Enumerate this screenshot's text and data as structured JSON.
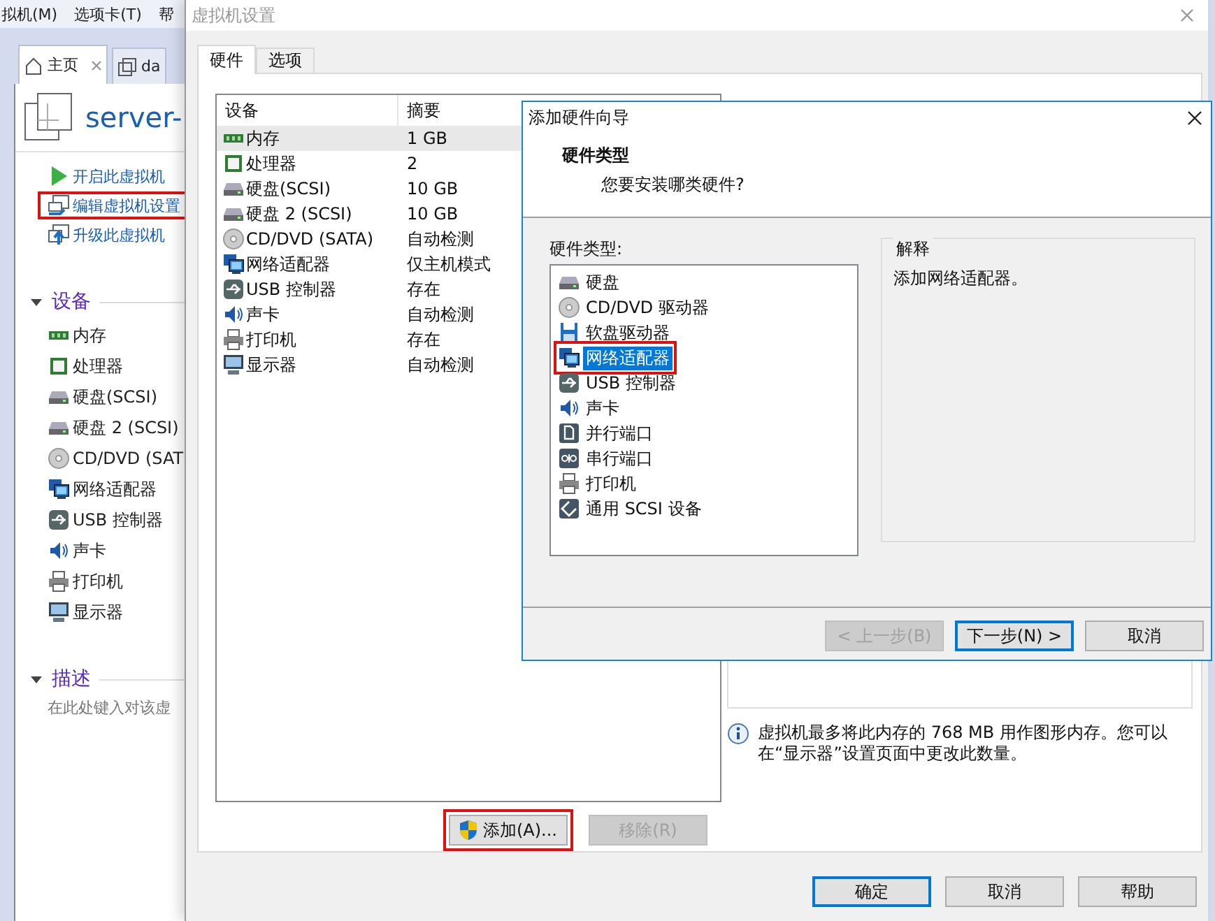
{
  "app": {
    "menu": [
      "拟机(M)",
      "选项卡(T)",
      "帮"
    ],
    "tabs": [
      {
        "label": "主页",
        "selected": true,
        "closable": true
      },
      {
        "label": "da",
        "selected": false,
        "closable": false
      }
    ],
    "vm_name": "server-",
    "actions": [
      {
        "label": "开启此虚拟机",
        "kind": "power",
        "highlighted": false
      },
      {
        "label": "编辑虚拟机设置",
        "kind": "edit",
        "highlighted": true
      },
      {
        "label": "升级此虚拟机",
        "kind": "upgrade",
        "highlighted": false
      }
    ],
    "devices_section": {
      "title": "设备",
      "expanded": true,
      "items": [
        {
          "label": "内存",
          "kind": "memory"
        },
        {
          "label": "处理器",
          "kind": "cpu"
        },
        {
          "label": "硬盘(SCSI)",
          "kind": "disk"
        },
        {
          "label": "硬盘 2 (SCSI)",
          "kind": "disk"
        },
        {
          "label": "CD/DVD (SAT",
          "kind": "cdrom"
        },
        {
          "label": "网络适配器",
          "kind": "network"
        },
        {
          "label": "USB 控制器",
          "kind": "usb"
        },
        {
          "label": "声卡",
          "kind": "sound"
        },
        {
          "label": "打印机",
          "kind": "printer"
        },
        {
          "label": "显示器",
          "kind": "display"
        }
      ]
    },
    "description_section": {
      "title": "描述",
      "expanded": true,
      "text": "在此处键入对该虚"
    }
  },
  "settings": {
    "title": "虚拟机设置",
    "tabs": [
      {
        "label": "硬件",
        "selected": true
      },
      {
        "label": "选项",
        "selected": false
      }
    ],
    "columns": [
      "设备",
      "摘要"
    ],
    "rows": [
      {
        "device": "内存",
        "summary": "1 GB",
        "kind": "memory",
        "selected": true
      },
      {
        "device": "处理器",
        "summary": "2",
        "kind": "cpu",
        "selected": false
      },
      {
        "device": "硬盘(SCSI)",
        "summary": "10 GB",
        "kind": "disk",
        "selected": false
      },
      {
        "device": "硬盘 2 (SCSI)",
        "summary": "10 GB",
        "kind": "disk",
        "selected": false
      },
      {
        "device": "CD/DVD (SATA)",
        "summary": "自动检测",
        "kind": "cdrom",
        "selected": false
      },
      {
        "device": "网络适配器",
        "summary": "仅主机模式",
        "kind": "network",
        "selected": false
      },
      {
        "device": "USB 控制器",
        "summary": "存在",
        "kind": "usb",
        "selected": false
      },
      {
        "device": "声卡",
        "summary": "自动检测",
        "kind": "sound",
        "selected": false
      },
      {
        "device": "打印机",
        "summary": "存在",
        "kind": "printer",
        "selected": false
      },
      {
        "device": "显示器",
        "summary": "自动检测",
        "kind": "display",
        "selected": false
      }
    ],
    "add_button": {
      "label": "添加(A)...",
      "disabled": false,
      "highlighted": true
    },
    "remove_button": {
      "label": "移除(R)",
      "disabled": true,
      "highlighted": false
    },
    "note": "虚拟机最多将此内存的 768 MB 用作图形内存。您可以在“显示器”设置页面中更改此数量。",
    "buttons": [
      {
        "label": "确定",
        "default": true
      },
      {
        "label": "取消",
        "default": false
      },
      {
        "label": "帮助",
        "default": false
      }
    ]
  },
  "wizard": {
    "title": "添加硬件向导",
    "heading": "硬件类型",
    "subheading": "您要安装哪类硬件?",
    "list_label": "硬件类型:",
    "items": [
      {
        "label": "硬盘",
        "kind": "disk",
        "selected": false,
        "highlighted": false
      },
      {
        "label": "CD/DVD 驱动器",
        "kind": "cdrom",
        "selected": false,
        "highlighted": false
      },
      {
        "label": "软盘驱动器",
        "kind": "floppy",
        "selected": false,
        "highlighted": false
      },
      {
        "label": "网络适配器",
        "kind": "network",
        "selected": true,
        "highlighted": true
      },
      {
        "label": "USB 控制器",
        "kind": "usb",
        "selected": false,
        "highlighted": false
      },
      {
        "label": "声卡",
        "kind": "sound",
        "selected": false,
        "highlighted": false
      },
      {
        "label": "并行端口",
        "kind": "parallel",
        "selected": false,
        "highlighted": false
      },
      {
        "label": "串行端口",
        "kind": "serial",
        "selected": false,
        "highlighted": false
      },
      {
        "label": "打印机",
        "kind": "printer",
        "selected": false,
        "highlighted": false
      },
      {
        "label": "通用 SCSI 设备",
        "kind": "scsi",
        "selected": false,
        "highlighted": false
      }
    ],
    "explanation": {
      "title": "解释",
      "text": "添加网络适配器。"
    },
    "buttons": [
      {
        "label": "< 上一步(B)",
        "disabled": true,
        "default": false
      },
      {
        "label": "下一步(N) >",
        "disabled": false,
        "default": true
      },
      {
        "label": "取消",
        "disabled": false,
        "default": false
      }
    ]
  }
}
